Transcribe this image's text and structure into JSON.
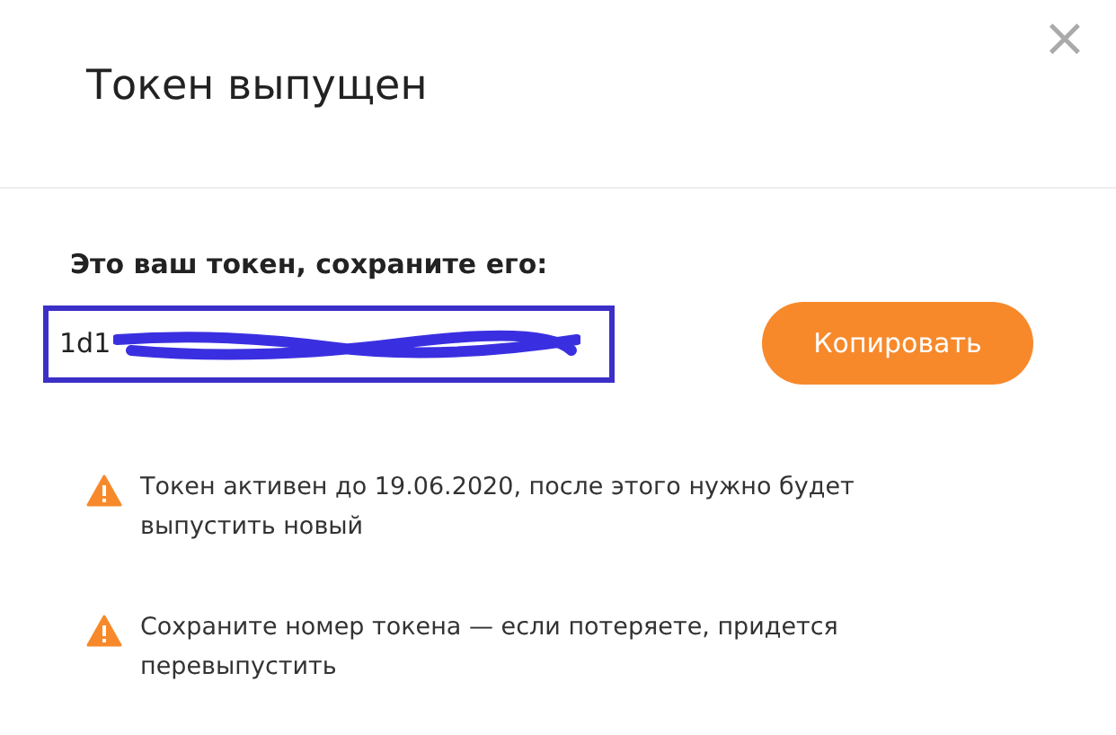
{
  "dialog": {
    "title": "Токен выпущен",
    "close": "×"
  },
  "token": {
    "label": "Это ваш токен, сохраните его:",
    "value": "1d1",
    "copy_button": "Копировать"
  },
  "warnings": [
    {
      "text": "Токен активен до 19.06.2020, после этого нужно будет выпустить новый"
    },
    {
      "text": "Сохраните номер токена — если потеряете, придется перевыпустить"
    }
  ]
}
